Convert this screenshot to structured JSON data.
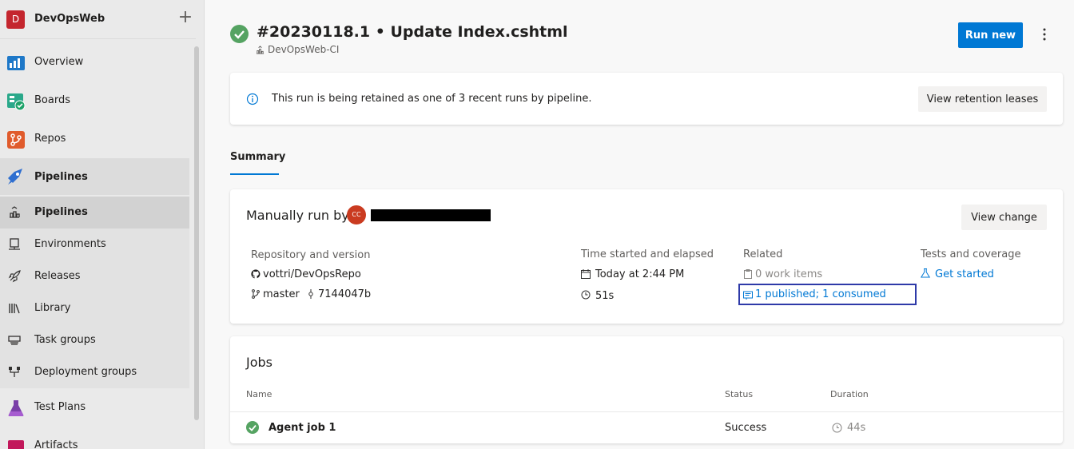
{
  "sidebar": {
    "org_initial": "D",
    "org_name": "DevOpsWeb",
    "plus_label": "+",
    "items": [
      {
        "label": "Overview",
        "icon": "overview-icon"
      },
      {
        "label": "Boards",
        "icon": "boards-icon"
      },
      {
        "label": "Repos",
        "icon": "repos-icon"
      },
      {
        "label": "Pipelines",
        "icon": "pipelines-icon"
      }
    ],
    "pipeline_subitems": [
      {
        "label": "Pipelines",
        "icon": "pipelines-sub-icon"
      },
      {
        "label": "Environments",
        "icon": "environments-icon"
      },
      {
        "label": "Releases",
        "icon": "releases-icon"
      },
      {
        "label": "Library",
        "icon": "library-icon"
      },
      {
        "label": "Task groups",
        "icon": "task-groups-icon"
      },
      {
        "label": "Deployment groups",
        "icon": "deployment-groups-icon"
      }
    ],
    "bottom_items": [
      {
        "label": "Test Plans",
        "icon": "test-plans-icon"
      },
      {
        "label": "Artifacts",
        "icon": "artifacts-icon"
      }
    ]
  },
  "header": {
    "title": "#20230118.1 • Update Index.cshtml",
    "pipeline": "DevOpsWeb-CI",
    "run_new": "Run new"
  },
  "retention": {
    "message": "This run is being retained as one of 3 recent runs by pipeline.",
    "button": "View retention leases"
  },
  "tabs": {
    "summary": "Summary"
  },
  "summary": {
    "manual_run_label": "Manually run by",
    "user_initials": "CC",
    "view_change": "View change",
    "repo_header": "Repository and version",
    "repo": "vottri/DevOpsRepo",
    "branch": "master",
    "commit": "7144047b",
    "time_header": "Time started and elapsed",
    "started": "Today at 2:44 PM",
    "elapsed": "51s",
    "related_header": "Related",
    "work_items": "0 work items",
    "artifacts": "1 published; 1 consumed",
    "tests_header": "Tests and coverage",
    "get_started": "Get started"
  },
  "jobs": {
    "title": "Jobs",
    "columns": {
      "name": "Name",
      "status": "Status",
      "duration": "Duration"
    },
    "rows": [
      {
        "name": "Agent job 1",
        "status": "Success",
        "duration": "44s"
      }
    ]
  },
  "colors": {
    "accent": "#0078d4",
    "success": "#55a362",
    "org_avatar": "#c4262e",
    "user_avatar": "#ca3b20"
  }
}
